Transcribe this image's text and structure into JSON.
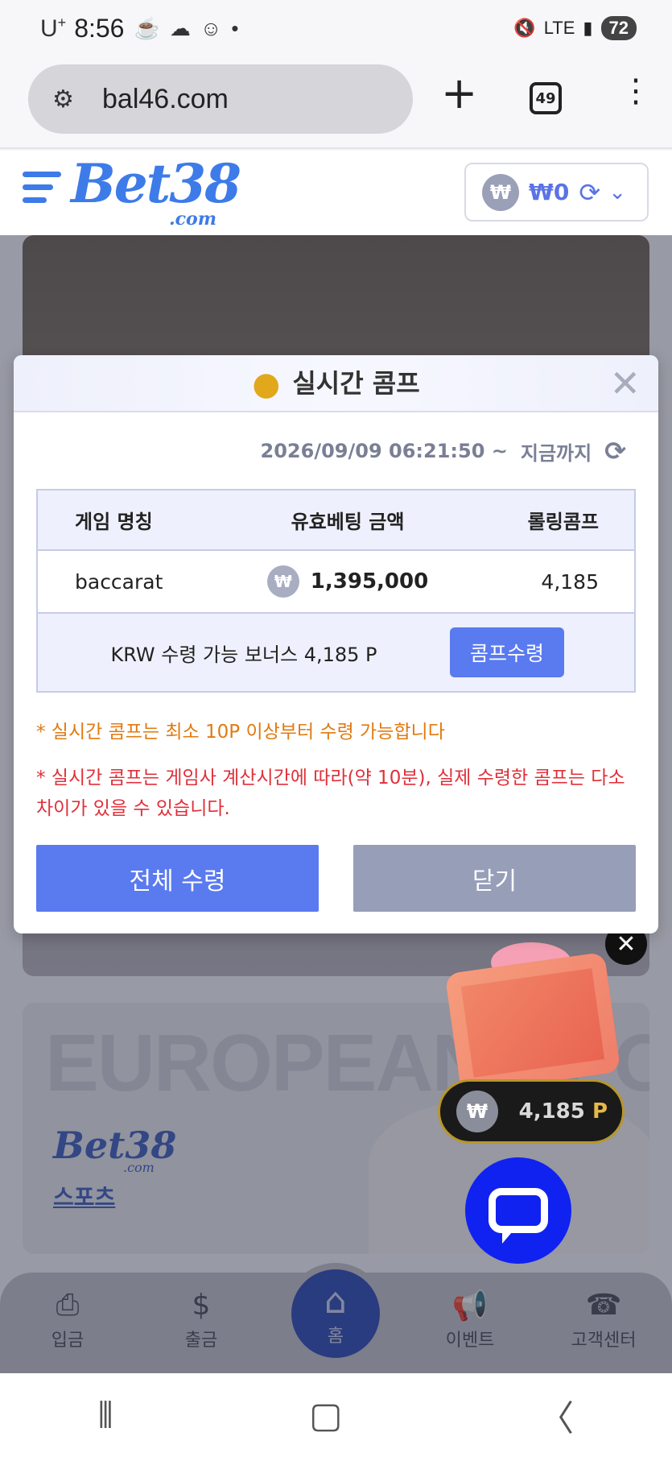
{
  "status_bar": {
    "carrier": "U",
    "carrier_sup": "+",
    "time": "8:56",
    "network": "LTE",
    "battery": "72"
  },
  "browser": {
    "url": "bal46.com",
    "tab_count": "49",
    "new_tab": "+"
  },
  "site": {
    "logo": "Bet38",
    "logo_sub": ".com",
    "wallet_currency_symbol": "₩",
    "wallet_balance": "₩0"
  },
  "background": {
    "banner2_text": "EUROPEAN SPO",
    "banner2_logo": "Bet38",
    "banner2_logo_sub": ".com",
    "banner2_label": "스포츠"
  },
  "bottom_nav": {
    "items": [
      {
        "label": "입금"
      },
      {
        "label": "출금"
      },
      {
        "label": "홈"
      },
      {
        "label": "이벤트"
      },
      {
        "label": "고객센터"
      }
    ]
  },
  "floating": {
    "comp_symbol": "₩",
    "comp_value": "4,185",
    "comp_unit": "P"
  },
  "modal": {
    "title": "실시간 콤프",
    "period_start": "2026/09/09 06:21:50 ~",
    "period_end": "지금까지",
    "table": {
      "headers": [
        "게임 명칭",
        "유효베팅 금액",
        "롤링콤프"
      ],
      "rows": [
        {
          "game": "baccarat",
          "symbol": "₩",
          "bet_amount": "1,395,000",
          "comp": "4,185"
        }
      ]
    },
    "bonus_text": "KRW 수령 가능 보너스 4,185 P",
    "claim_button": "콤프수령",
    "note_min": "* 실시간 콤프는 최소 10P 이상부터 수령 가능합니다",
    "note_diff": "* 실시간 콤프는 게임사 계산시간에 따라(약 10분), 실제 수령한 콤프는 다소 차이가 있을 수 있습니다.",
    "claim_all_button": "전체 수령",
    "close_button": "닫기"
  },
  "colors": {
    "accent": "#5a7af0",
    "brand": "#3d7be8",
    "note_orange": "#e07a12",
    "note_red": "#e0303a",
    "close_gray": "#979eb8"
  }
}
